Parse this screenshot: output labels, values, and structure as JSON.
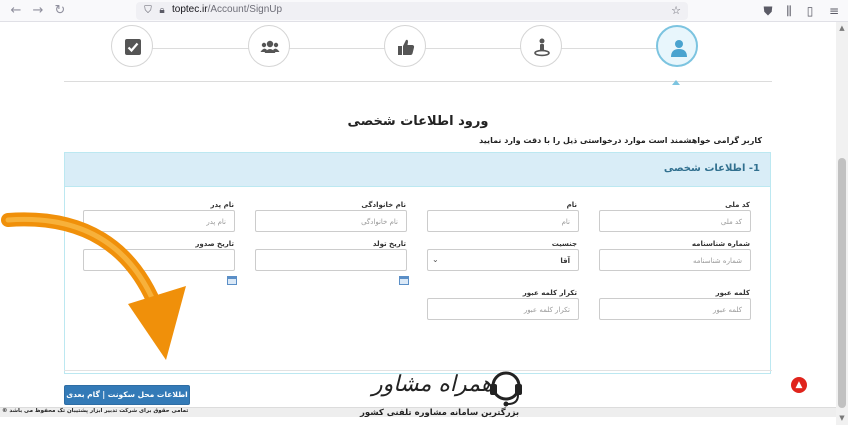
{
  "browser": {
    "url_host": "toptec.ir",
    "url_path": "/Account/SignUp"
  },
  "steps": [
    {
      "icon": "check-square-icon",
      "active": false
    },
    {
      "icon": "users-icon",
      "active": false
    },
    {
      "icon": "thumbs-up-icon",
      "active": false
    },
    {
      "icon": "person-pin-icon",
      "active": false
    },
    {
      "icon": "user-icon",
      "active": true
    }
  ],
  "page": {
    "title": "ورود اطلاعات شخصی",
    "description": "کاربر گرامی خواهشمند است موارد درخواستی ذیل را با دقت وارد نمایید"
  },
  "panel": {
    "heading": "1- اطلاعات شخصی"
  },
  "form": {
    "national_code": {
      "label": "کد ملی",
      "placeholder": "کد ملی"
    },
    "first_name": {
      "label": "نام",
      "placeholder": "نام"
    },
    "last_name": {
      "label": "نام خانوادگی",
      "placeholder": "نام خانوادگی"
    },
    "father_name": {
      "label": "نام پدر",
      "placeholder": "نام پدر"
    },
    "id_number": {
      "label": "شماره شناسنامه",
      "placeholder": "شماره شناسنامه"
    },
    "gender": {
      "label": "جنسیت",
      "value": "آقا"
    },
    "birth_date": {
      "label": "تاریخ تولد",
      "placeholder": ""
    },
    "issue_date": {
      "label": "تاریخ صدور",
      "placeholder": ""
    },
    "password": {
      "label": "کلمه عبور",
      "placeholder": "کلمه عبور"
    },
    "password_repeat": {
      "label": "تکرار کلمه عبور",
      "placeholder": "تکرار کلمه عبور"
    }
  },
  "next_button": {
    "label": "اطلاعات محل سکونت | گام بعدی"
  },
  "footer": {
    "copyright": "تمامی حقوق برای شرکت تدبیر ابزار پشتیبان تک محفوظ می باشد"
  },
  "watermark": {
    "name": "همراه مشاور",
    "tagline": "بزرگترین سامانه مشاوره تلفنی کشور"
  },
  "colors": {
    "primary_button": "#337ab7",
    "panel_heading_bg": "#d9edf7",
    "active_step_border": "#7cc4e0",
    "scroll_top_button": "#e0241c",
    "annotation_arrow": "#f0900a"
  }
}
